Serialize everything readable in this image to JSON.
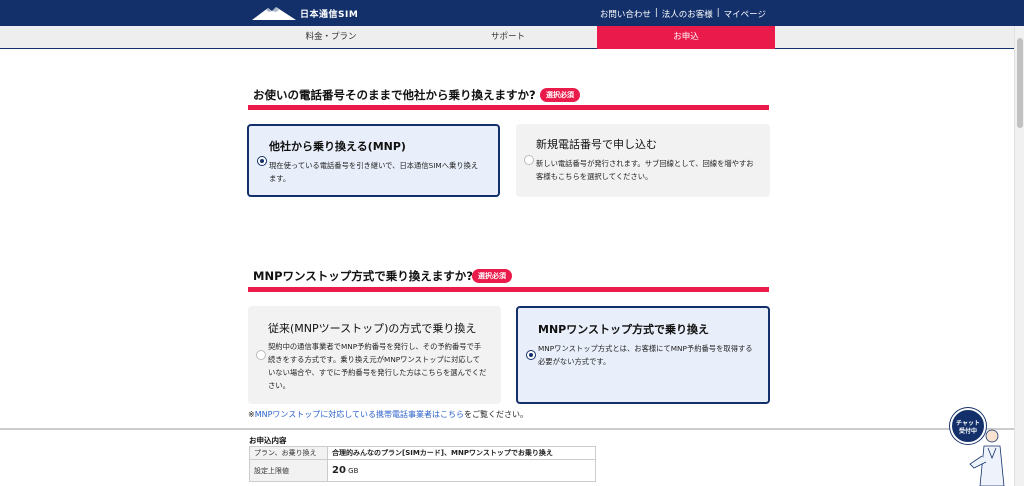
{
  "header": {
    "logo_text": "日本通信SIM",
    "links": [
      "お問い合わせ",
      "|",
      "法人のお客様",
      "|",
      "マイページ"
    ]
  },
  "nav": {
    "items": [
      "料金・プラン",
      "サポート",
      "お申込"
    ]
  },
  "section1": {
    "title": "お使いの電話番号そのままで他社から乗り換えますか?",
    "required": "選択必須",
    "options": [
      {
        "title": "他社から乗り換える(MNP)",
        "desc": "現在使っている電話番号を引き継いで、日本通信SIMへ乗り換えます。",
        "selected": true
      },
      {
        "title": "新規電話番号で申し込む",
        "desc": "新しい電話番号が発行されます。サブ回線として、回線を増やすお客様もこちらを選択してください。",
        "selected": false
      }
    ]
  },
  "section2": {
    "title": "MNPワンストップ方式で乗り換えますか?",
    "required": "選択必須",
    "options": [
      {
        "title": "従来(MNPツーストップ)の方式で乗り換え",
        "desc": "契約中の通信事業者でMNP予約番号を発行し、その予約番号で手続きをする方式です。乗り換え元がMNPワンストップに対応していない場合や、すでに予約番号を発行した方はこちらを選んでください。",
        "selected": false
      },
      {
        "title": "MNPワンストップ方式で乗り換え",
        "desc": "MNPワンストップ方式とは、お客様にてMNP予約番号を取得する必要がない方式です。",
        "selected": true
      }
    ]
  },
  "note": {
    "prefix": "※",
    "link": "MNPワンストップに対応している携帯電話事業者はこちら",
    "suffix": "をご覧ください。"
  },
  "summary": {
    "title": "お申込内容",
    "rows": [
      {
        "label": "プラン、お乗り換え",
        "value": "合理的みんなのプラン[SIMカード]、MNPワンストップでお乗り換え"
      },
      {
        "label": "設定上限値",
        "value_num": "20",
        "value_unit": "GB"
      }
    ]
  },
  "chat": {
    "line1": "チャット",
    "line2": "受付中"
  }
}
